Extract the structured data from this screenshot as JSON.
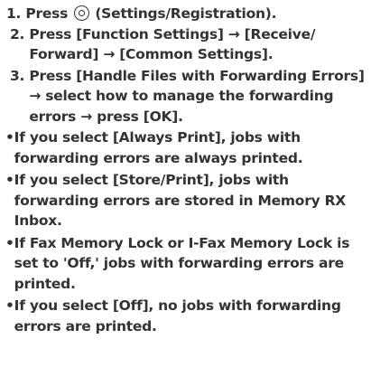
{
  "steps": [
    {
      "num": "1. ",
      "before_icon": "Press ",
      "icon": "settings-registration-icon",
      "after_icon": " (Settings/Registration)."
    },
    {
      "num": "2. ",
      "text": "Press [Function Settings] → [Receive/ Forward] → [Common Settings]."
    },
    {
      "num": "3. ",
      "text": "Press [Handle Files with Forwarding Errors] → select how to manage the forwarding errors → press [OK]."
    }
  ],
  "bullet_mark": "•",
  "notes": [
    "If you select [Always Print], jobs with forwarding errors are always printed.",
    "If you select [Store/Print], jobs with forwarding errors are stored in Memory RX Inbox.",
    "If Fax Memory Lock or I-Fax Memory Lock is set to 'Off,' jobs with forwarding errors are printed.",
    "If you select [Off], no jobs with forwarding errors are printed."
  ]
}
